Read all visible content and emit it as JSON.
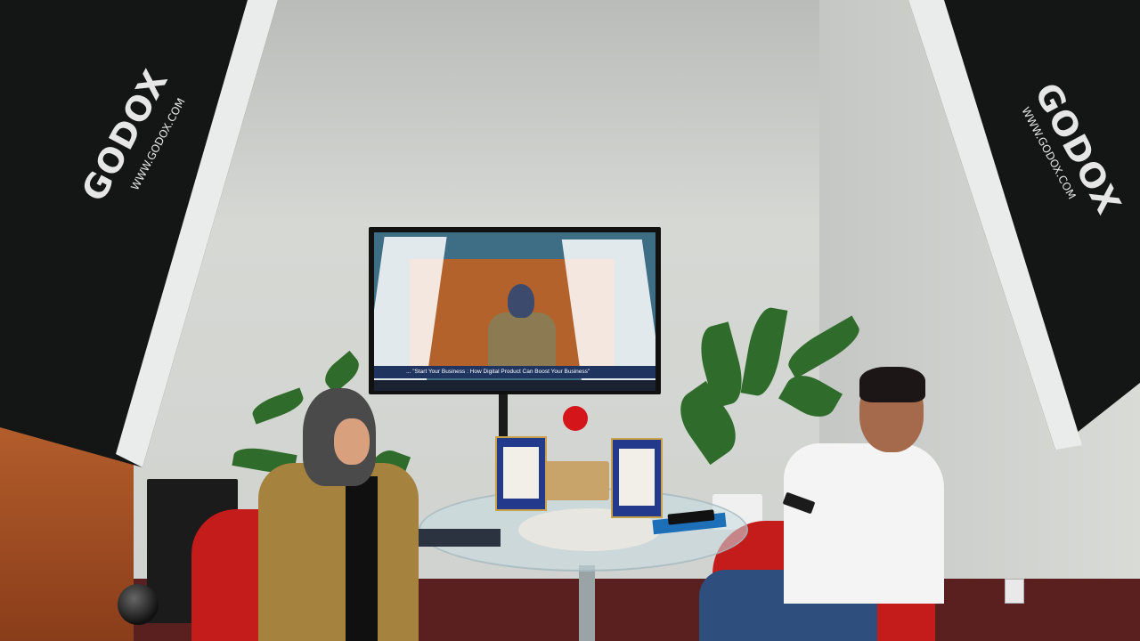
{
  "scene": {
    "description_hidden": "",
    "softbox_left": {
      "brand": "GODOX",
      "url": "WWW.GODOX.COM"
    },
    "softbox_right": {
      "brand": "GODOX",
      "url": "WWW.GODOX.COM"
    },
    "tv": {
      "banner_text": "... \"Start Your Business : How Digital Product Can Boost Your Business\""
    }
  },
  "colors": {
    "wall": "#cfd2ce",
    "chair_red": "#c41b1b",
    "jacket": "#a5833e",
    "award_blue": "#233a8c"
  }
}
